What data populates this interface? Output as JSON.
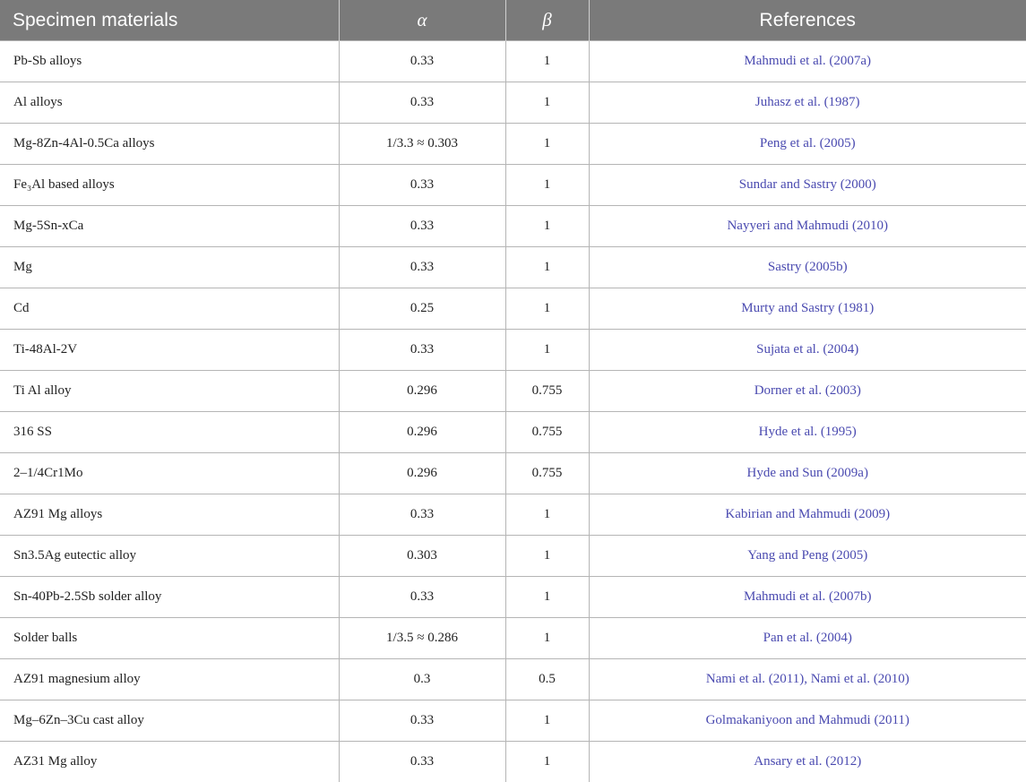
{
  "header": {
    "col1": "Specimen materials",
    "col2": "α",
    "col3": "β",
    "col4": "References"
  },
  "rows": [
    {
      "material": "Pb-Sb alloys",
      "alpha": "0.33",
      "beta": "1",
      "ref": "Mahmudi et al. (2007a)"
    },
    {
      "material": "Al alloys",
      "alpha": "0.33",
      "beta": "1",
      "ref": "Juhasz et al. (1987)"
    },
    {
      "material": "Mg-8Zn-4Al-0.5Ca alloys",
      "alpha": "1/3.3 ≈ 0.303",
      "beta": "1",
      "ref": "Peng et al. (2005)"
    },
    {
      "material": "Fe₃Al based alloys",
      "alpha": "0.33",
      "beta": "1",
      "ref": "Sundar and Sastry (2000)"
    },
    {
      "material": "Mg-5Sn-xCa",
      "alpha": "0.33",
      "beta": "1",
      "ref": "Nayyeri and Mahmudi (2010)"
    },
    {
      "material": "Mg",
      "alpha": "0.33",
      "beta": "1",
      "ref": "Sastry (2005b)"
    },
    {
      "material": "Cd",
      "alpha": "0.25",
      "beta": "1",
      "ref": "Murty and Sastry (1981)"
    },
    {
      "material": "Ti-48Al-2V",
      "alpha": "0.33",
      "beta": "1",
      "ref": "Sujata et al. (2004)"
    },
    {
      "material": "Ti Al alloy",
      "alpha": "0.296",
      "beta": "0.755",
      "ref": "Dorner et al. (2003)"
    },
    {
      "material": "316 SS",
      "alpha": "0.296",
      "beta": "0.755",
      "ref": "Hyde et al. (1995)"
    },
    {
      "material": "2–1/4Cr1Mo",
      "alpha": "0.296",
      "beta": "0.755",
      "ref": "Hyde and Sun (2009a)"
    },
    {
      "material": "AZ91 Mg alloys",
      "alpha": "0.33",
      "beta": "1",
      "ref": "Kabirian and Mahmudi (2009)"
    },
    {
      "material": "Sn3.5Ag eutectic alloy",
      "alpha": "0.303",
      "beta": "1",
      "ref": "Yang and Peng (2005)"
    },
    {
      "material": "Sn-40Pb-2.5Sb solder alloy",
      "alpha": "0.33",
      "beta": "1",
      "ref": "Mahmudi et al. (2007b)"
    },
    {
      "material": "Solder balls",
      "alpha": "1/3.5 ≈ 0.286",
      "beta": "1",
      "ref": "Pan et al. (2004)"
    },
    {
      "material": "AZ91 magnesium alloy",
      "alpha": "0.3",
      "beta": "0.5",
      "ref": "Nami et al. (2011), Nami et al. (2010)"
    },
    {
      "material": "Mg–6Zn–3Cu cast alloy",
      "alpha": "0.33",
      "beta": "1",
      "ref": "Golmakaniyoon and Mahmudi (2011)"
    },
    {
      "material": "AZ31 Mg alloy",
      "alpha": "0.33",
      "beta": "1",
      "ref": "Ansary et al. (2012)"
    }
  ],
  "colors": {
    "header_bg": "#7a7a7a",
    "header_text": "#ffffff",
    "reference_link": "#4a4ab0",
    "grid_line": "#b5b5b5"
  }
}
